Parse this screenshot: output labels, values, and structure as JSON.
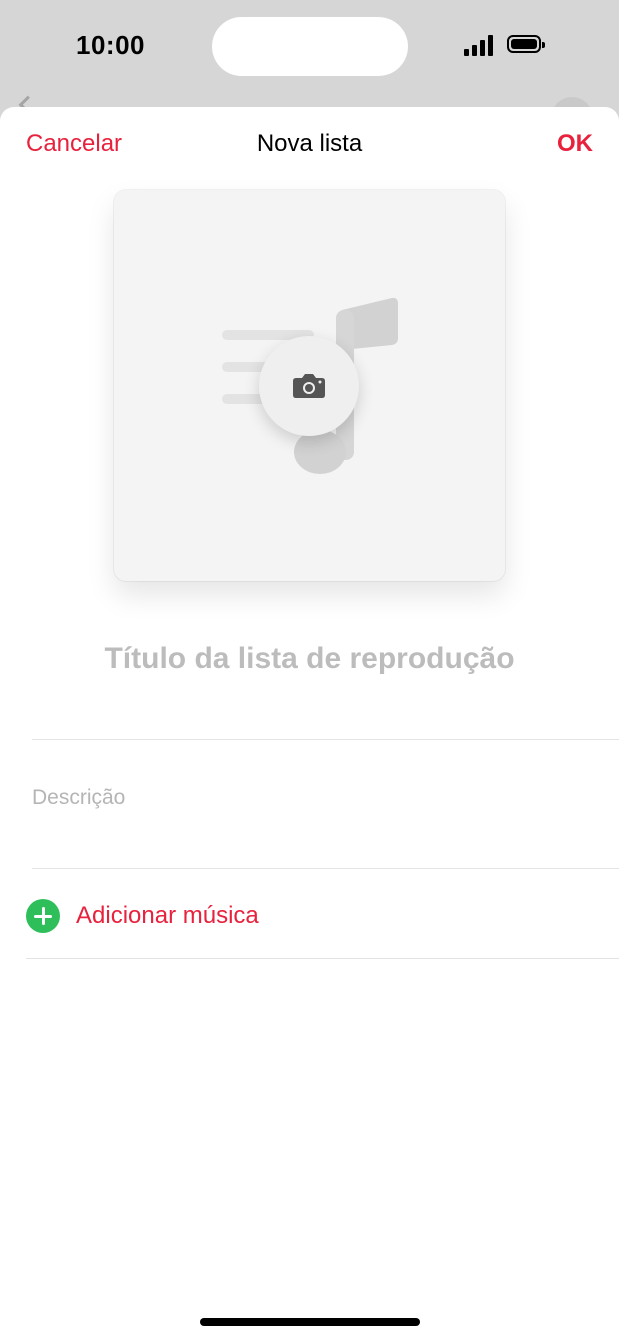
{
  "status_bar": {
    "time": "10:00"
  },
  "nav": {
    "cancel_label": "Cancelar",
    "title": "Nova lista",
    "ok_label": "OK"
  },
  "artwork": {
    "placeholder_icon": "music-note-icon",
    "action_icon": "camera-icon"
  },
  "title_field": {
    "placeholder": "Título da lista de reprodução",
    "value": ""
  },
  "description_field": {
    "placeholder": "Descrição",
    "value": ""
  },
  "add_music": {
    "label": "Adicionar música",
    "icon": "plus-circle-icon"
  },
  "colors": {
    "accent": "#e8213c",
    "add_icon": "#2fbf5a",
    "placeholder_text": "#bcbcbc"
  }
}
